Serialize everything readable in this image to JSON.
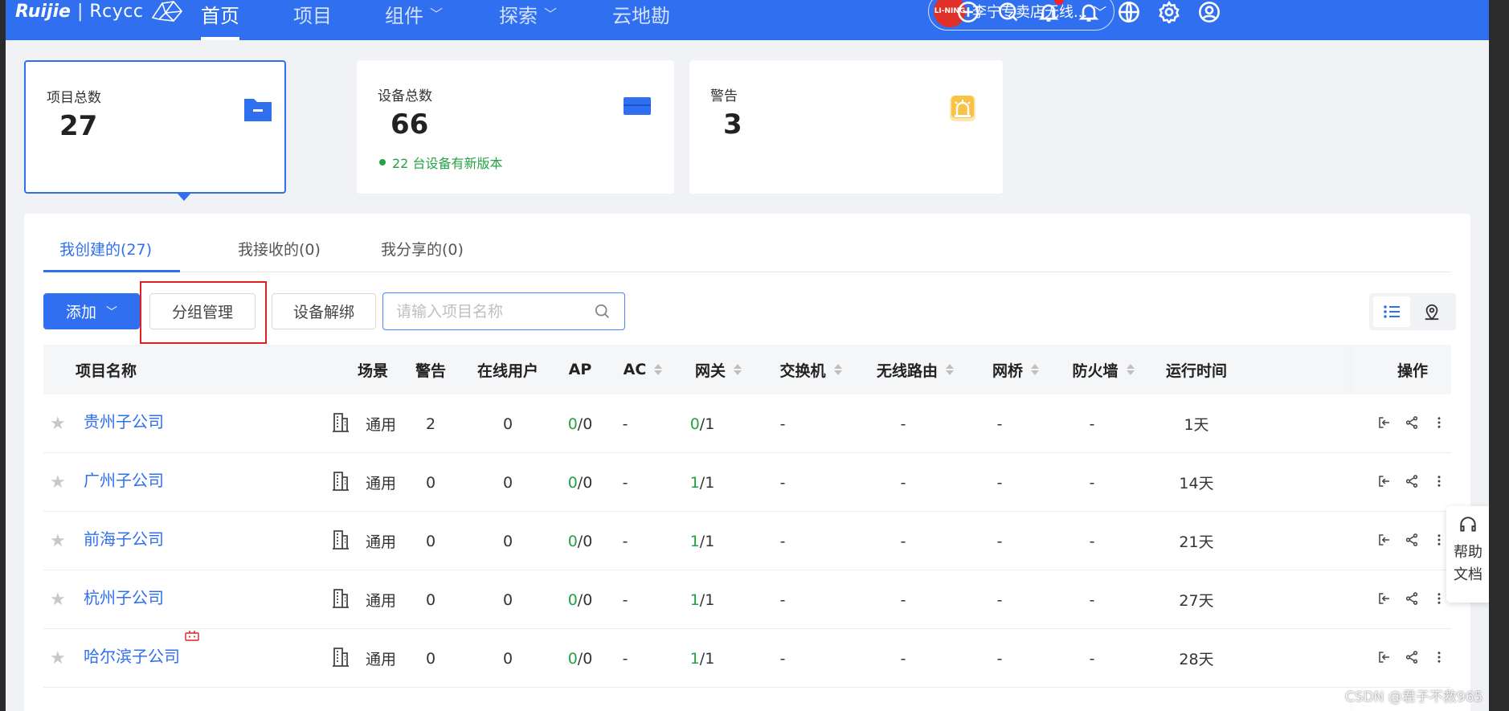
{
  "brand": {
    "name": "Ruijie",
    "sub": "Rcycc"
  },
  "nav": [
    {
      "label": "首页",
      "active": true
    },
    {
      "label": "项目"
    },
    {
      "label": "组件"
    },
    {
      "label": "探索"
    },
    {
      "label": "云地勘"
    }
  ],
  "org": {
    "logo_text": "LI-NING",
    "name": "李宁专卖店无线..."
  },
  "top_icons": [
    "add-circle-icon",
    "search-icon",
    "notification-bell-icon",
    "bell-icon",
    "globe-icon",
    "settings-icon",
    "user-icon"
  ],
  "cards": [
    {
      "label": "项目总数",
      "value": "27",
      "icon": "folder-icon"
    },
    {
      "label": "设备总数",
      "value": "66",
      "note": "22 台设备有新版本",
      "icon": "device-icon"
    },
    {
      "label": "警告",
      "value": "3",
      "icon": "alarm-icon"
    }
  ],
  "tabs": [
    "我创建的(27)",
    "我接收的(0)",
    "我分享的(0)"
  ],
  "toolbar": {
    "add_label": "添加",
    "group_label": "分组管理",
    "unbind_label": "设备解绑",
    "search_placeholder": "请输入项目名称"
  },
  "table": {
    "headers": [
      "项目名称",
      "场景",
      "警告",
      "在线用户",
      "AP",
      "AC",
      "网关",
      "交换机",
      "无线路由",
      "网桥",
      "防火墙",
      "运行时间",
      "操作"
    ],
    "rows": [
      {
        "name": "贵州子公司",
        "scene": "通用",
        "warn": "2",
        "online": "0",
        "ap_on": "0",
        "ap_total": "/0",
        "ac": "-",
        "gw_on": "0",
        "gw_total": "/1",
        "switch": "-",
        "wr": "-",
        "bridge": "-",
        "fw": "-",
        "uptime": "1天"
      },
      {
        "name": "广州子公司",
        "scene": "通用",
        "warn": "0",
        "online": "0",
        "ap_on": "0",
        "ap_total": "/0",
        "ac": "-",
        "gw_on": "1",
        "gw_total": "/1",
        "switch": "-",
        "wr": "-",
        "bridge": "-",
        "fw": "-",
        "uptime": "14天"
      },
      {
        "name": "前海子公司",
        "scene": "通用",
        "warn": "0",
        "online": "0",
        "ap_on": "0",
        "ap_total": "/0",
        "ac": "-",
        "gw_on": "1",
        "gw_total": "/1",
        "switch": "-",
        "wr": "-",
        "bridge": "-",
        "fw": "-",
        "uptime": "21天"
      },
      {
        "name": "杭州子公司",
        "scene": "通用",
        "warn": "0",
        "online": "0",
        "ap_on": "0",
        "ap_total": "/0",
        "ac": "-",
        "gw_on": "1",
        "gw_total": "/1",
        "switch": "-",
        "wr": "-",
        "bridge": "-",
        "fw": "-",
        "uptime": "27天"
      },
      {
        "name": "哈尔滨子公司",
        "scene": "通用",
        "warn": "0",
        "online": "0",
        "ap_on": "0",
        "ap_total": "/0",
        "ac": "-",
        "gw_on": "1",
        "gw_total": "/1",
        "switch": "-",
        "wr": "-",
        "bridge": "-",
        "fw": "-",
        "uptime": "28天"
      }
    ]
  },
  "help": {
    "line1": "帮助",
    "line2": "文档"
  },
  "watermark": "CSDN @君子不救965",
  "colors": {
    "primary": "#2f6ff0",
    "success": "#25a243",
    "highlight": "#e02020"
  }
}
